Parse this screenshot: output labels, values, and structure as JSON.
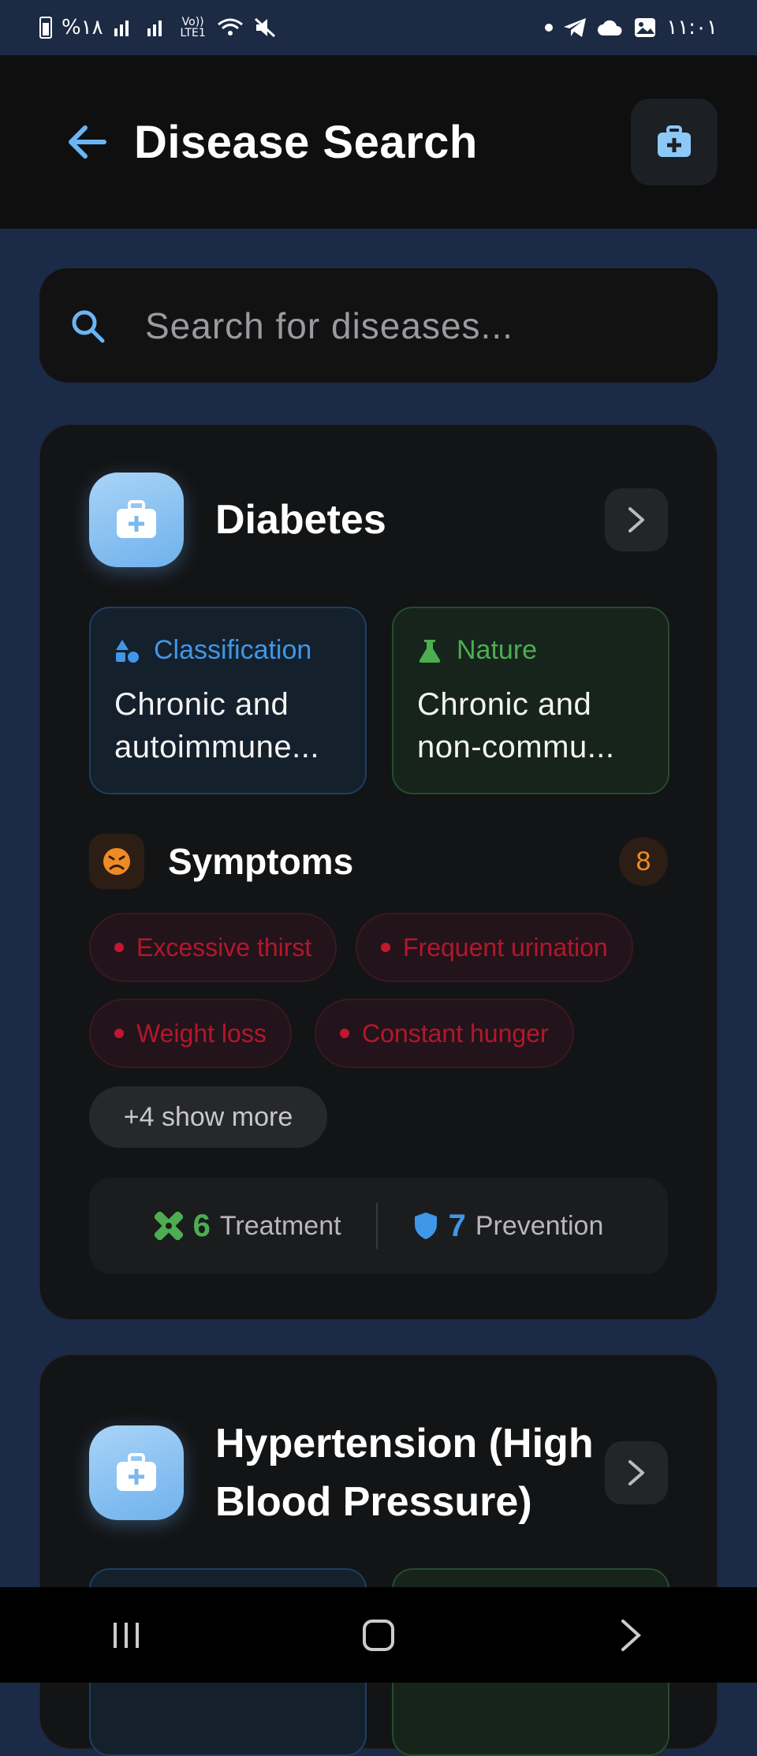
{
  "status_bar": {
    "left_text": "%۱۸",
    "network_label": "Vo)) LTE1",
    "time": "۱۱:۰۱"
  },
  "app_bar": {
    "title": "Disease Search"
  },
  "search": {
    "placeholder": "Search for diseases..."
  },
  "cards": [
    {
      "name": "Diabetes",
      "classification_label": "Classification",
      "classification_value": "Chronic and autoimmune...",
      "nature_label": "Nature",
      "nature_value": "Chronic and non-commu...",
      "symptoms_title": "Symptoms",
      "symptoms_count": "8",
      "symptoms": [
        "Excessive thirst",
        "Frequent urination",
        "Weight loss",
        "Constant hunger"
      ],
      "show_more": "+4 show more",
      "treatment_count": "6",
      "treatment_label": "Treatment",
      "prevention_count": "7",
      "prevention_label": "Prevention"
    },
    {
      "name": "Hypertension (High Blood Pressure)"
    }
  ],
  "colors": {
    "accent_blue": "#3f97e9",
    "accent_green": "#4cae50",
    "accent_orange": "#f08a24",
    "symptom_red": "#b5162c"
  },
  "icons": {
    "back": "arrow-left-icon",
    "kit": "medical-kit-icon",
    "search": "search-icon",
    "chevron": "chevron-right-icon",
    "classification": "shapes-icon",
    "nature": "flask-icon",
    "symptoms": "sick-face-icon",
    "treatment": "bandage-icon",
    "prevention": "shield-icon"
  }
}
